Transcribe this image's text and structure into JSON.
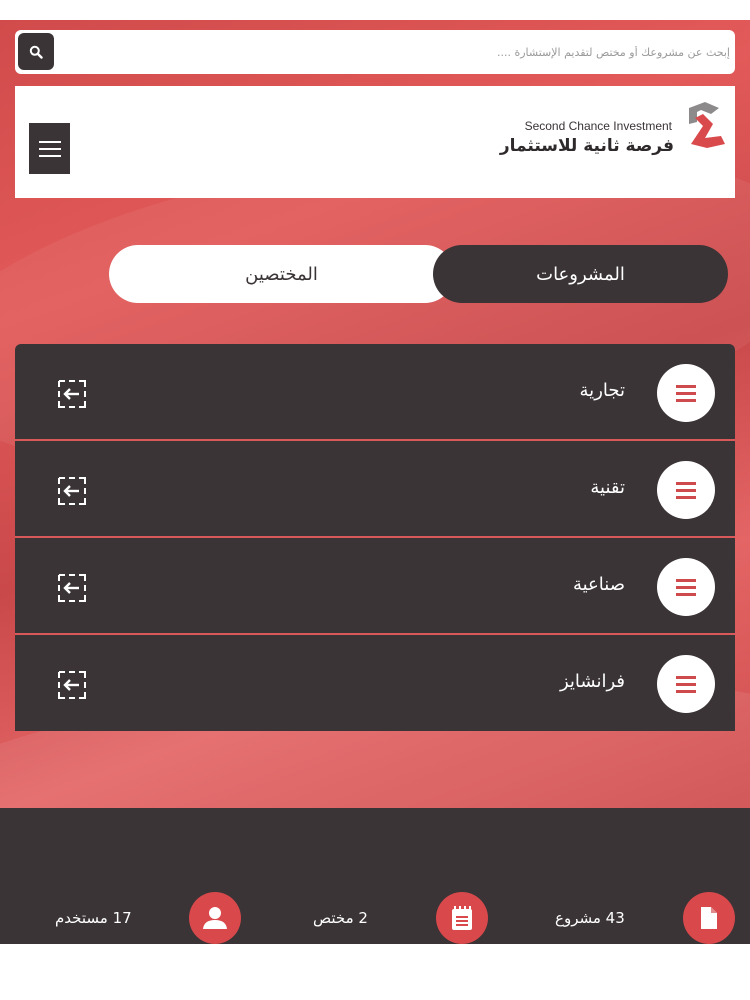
{
  "search": {
    "placeholder": "إبحث عن مشروعك أو مختص لتقديم الإستشارة ....",
    "button_icon": "search-icon"
  },
  "header": {
    "logo_text_en": "Second Chance Investment",
    "logo_text_ar": "فرصة ثانية للاستثمار",
    "menu_icon": "hamburger-icon"
  },
  "tabs": {
    "active_label": "المشروعات",
    "inactive_label": "المختصين"
  },
  "categories": [
    {
      "label": "تجارية",
      "icon": "list-icon",
      "action_icon": "enter-icon"
    },
    {
      "label": "تقنية",
      "icon": "list-icon",
      "action_icon": "enter-icon"
    },
    {
      "label": "صناعية",
      "icon": "list-icon",
      "action_icon": "enter-icon"
    },
    {
      "label": "فرانشايز",
      "icon": "list-icon",
      "action_icon": "enter-icon"
    }
  ],
  "stats": {
    "projects": {
      "text": "43 مشروع",
      "icon": "document-icon"
    },
    "specialists": {
      "text": "2 مختص",
      "icon": "notepad-icon"
    },
    "users": {
      "text": "17 مستخدم",
      "icon": "user-icon"
    }
  },
  "colors": {
    "brand_red": "#d9484b",
    "dark": "#3a3436",
    "white": "#ffffff"
  }
}
